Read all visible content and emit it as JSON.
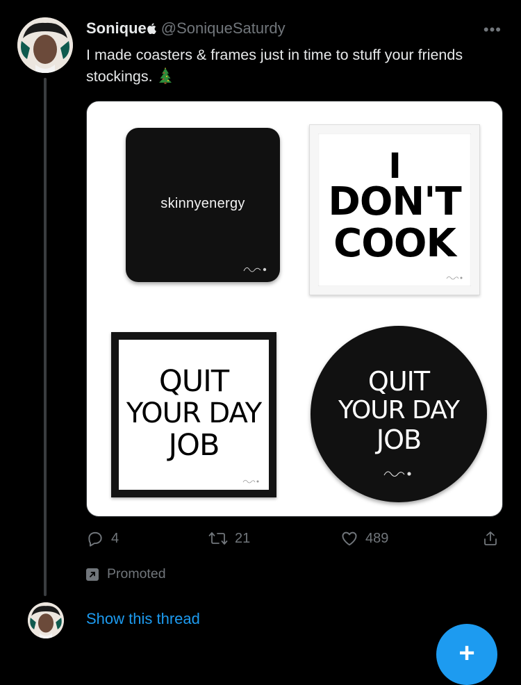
{
  "tweet": {
    "author_name": "Sonique",
    "author_badge": "",
    "handle": "@SoniqueSaturdy",
    "more_icon": "more-horizontal-icon",
    "text": "I made coasters & frames just in time to stuff your friends stockings.",
    "emoji": "christmas-tree-emoji"
  },
  "media": {
    "coaster_black_text": "skinnyenergy",
    "frame_white_lines": [
      "I",
      "DON'T",
      "COOK"
    ],
    "frame_black_lines": [
      "QUIT",
      "YOUR DAY",
      "JOB"
    ],
    "coaster_round_lines": [
      "QUIT",
      "YOUR DAY",
      "JOB"
    ]
  },
  "actions": {
    "reply_count": "4",
    "retweet_count": "21",
    "like_count": "489"
  },
  "promoted_label": "Promoted",
  "show_thread_label": "Show this thread",
  "colors": {
    "accent": "#1d9bf0",
    "muted": "#71767b",
    "background": "#000000",
    "text": "#e7e9ea"
  }
}
